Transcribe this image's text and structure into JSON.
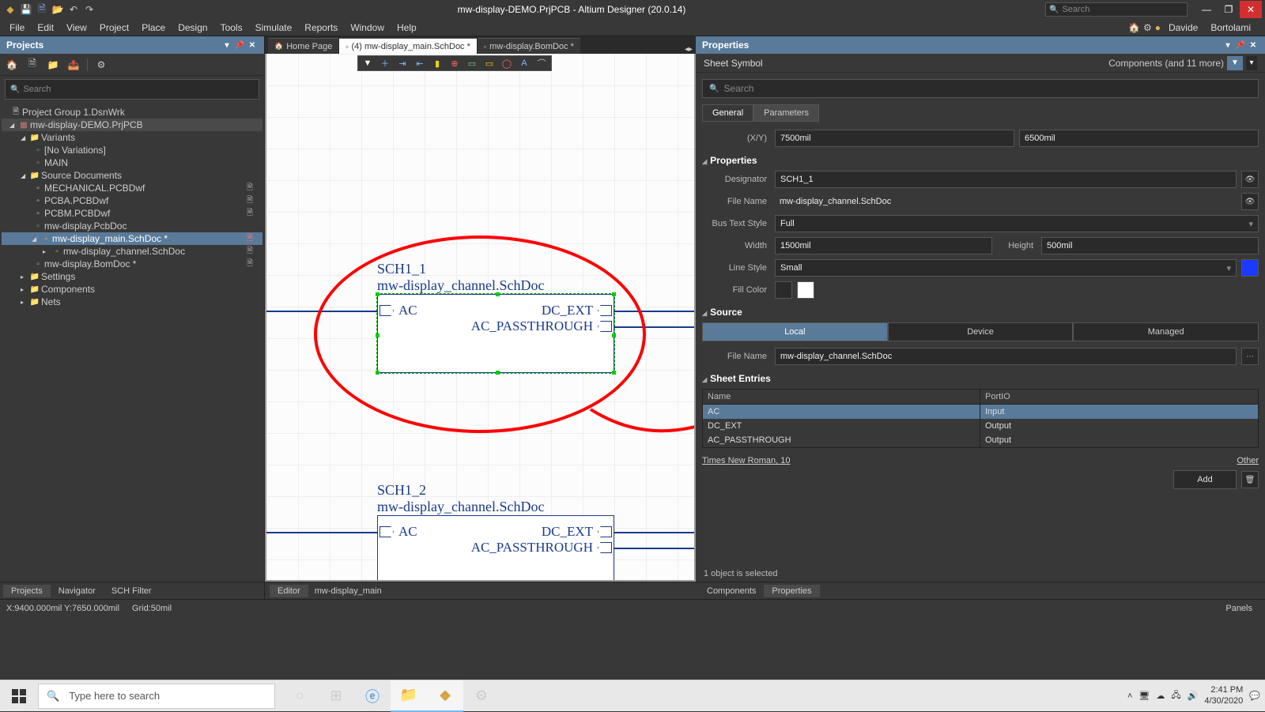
{
  "titlebar": {
    "title": "mw-display-DEMO.PrjPCB - Altium Designer (20.0.14)",
    "search_placeholder": "Search"
  },
  "menu": [
    "File",
    "Edit",
    "View",
    "Project",
    "Place",
    "Design",
    "Tools",
    "Simulate",
    "Reports",
    "Window",
    "Help"
  ],
  "user": {
    "first": "Davide",
    "last": "Bortolami"
  },
  "projects": {
    "title": "Projects",
    "search_placeholder": "Search",
    "tree": {
      "group": "Project Group 1.DsnWrk",
      "project": "mw-display-DEMO.PrjPCB",
      "variants_label": "Variants",
      "no_variations": "[No Variations]",
      "main": "MAIN",
      "source_docs_label": "Source Documents",
      "src": [
        "MECHANICAL.PCBDwf",
        "PCBA.PCBDwf",
        "PCBM.PCBDwf",
        "mw-display.PcbDoc",
        "mw-display_main.SchDoc *",
        "mw-display_channel.SchDoc",
        "mw-display.BomDoc *"
      ],
      "settings": "Settings",
      "components": "Components",
      "nets": "Nets"
    },
    "tabs": [
      "Projects",
      "Navigator",
      "SCH Filter"
    ]
  },
  "doc_tabs": {
    "home": "Home Page",
    "t1": "(4) mw-display_main.SchDoc *",
    "t2": "mw-display.BomDoc *"
  },
  "schematic": {
    "sym1": {
      "designator": "SCH1_1",
      "filename": "mw-display_channel.SchDoc",
      "p_in": "AC",
      "p_out1": "DC_EXT",
      "p_out2": "AC_PASSTHROUGH"
    },
    "sym2": {
      "designator": "SCH1_2",
      "filename": "mw-display_channel.SchDoc",
      "p_in": "AC",
      "p_out1": "DC_EXT",
      "p_out2": "AC_PASSTHROUGH"
    }
  },
  "editor_status": {
    "label": "Editor",
    "doc": "mw-display_main"
  },
  "properties": {
    "title": "Properties",
    "subtitle": "Sheet Symbol",
    "modes_text": "Components (and 11 more)",
    "search_placeholder": "Search",
    "tabs": {
      "general": "General",
      "parameters": "Parameters"
    },
    "xy_label": "(X/Y)",
    "x": "7500mil",
    "y": "6500mil",
    "sec_props": "Properties",
    "designator_label": "Designator",
    "designator": "SCH1_1",
    "filename_label": "File Name",
    "filename": "mw-display_channel.SchDoc",
    "bustext_label": "Bus Text Style",
    "bustext": "Full",
    "width_label": "Width",
    "width": "1500mil",
    "height_label": "Height",
    "height": "500mil",
    "linestyle_label": "Line Style",
    "linestyle": "Small",
    "fillcolor_label": "Fill Color",
    "sec_source": "Source",
    "src_tabs": {
      "local": "Local",
      "device": "Device",
      "managed": "Managed"
    },
    "src_filename_label": "File Name",
    "src_filename": "mw-display_channel.SchDoc",
    "sec_entries": "Sheet Entries",
    "col_name": "Name",
    "col_io": "PortIO",
    "entries": [
      {
        "name": "AC",
        "io": "Input"
      },
      {
        "name": "DC_EXT",
        "io": "Output"
      },
      {
        "name": "AC_PASSTHROUGH",
        "io": "Output"
      }
    ],
    "font": "Times New Roman, 10",
    "other": "Other",
    "add": "Add",
    "selected": "1 object is selected",
    "bottom_tabs": [
      "Components",
      "Properties"
    ]
  },
  "status": {
    "coords": "X:9400.000mil Y:7650.000mil",
    "grid": "Grid:50mil",
    "panels": "Panels"
  },
  "taskbar": {
    "search_placeholder": "Type here to search",
    "time": "2:41 PM",
    "date": "4/30/2020"
  }
}
